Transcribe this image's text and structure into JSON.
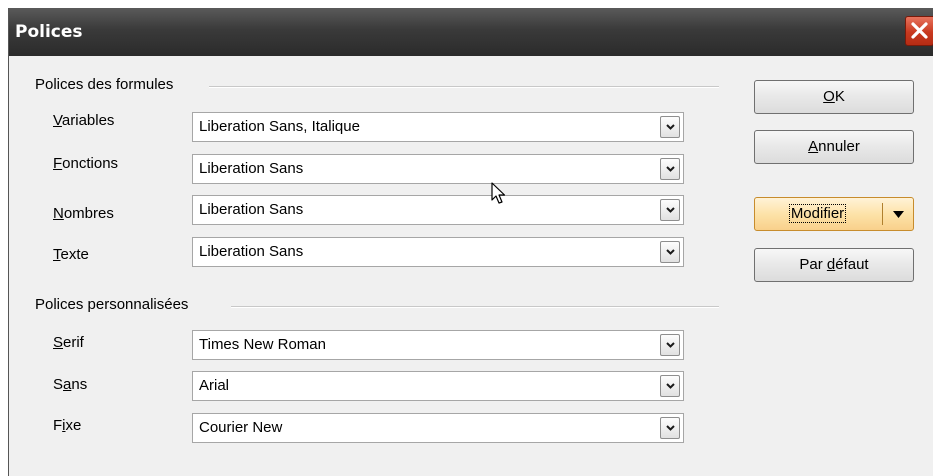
{
  "window": {
    "title": "Polices"
  },
  "groups": {
    "formulas": {
      "label": "Polices des formules",
      "fields": [
        {
          "label": "Variables",
          "key": "V",
          "rest": "ariables",
          "value": "Liberation Sans, Italique"
        },
        {
          "label": "Fonctions",
          "key": "F",
          "rest": "onctions",
          "value": "Liberation Sans"
        },
        {
          "label": "Nombres",
          "key": "N",
          "rest": "ombres",
          "value": "Liberation Sans"
        },
        {
          "label": "Texte",
          "key": "T",
          "rest": "exte",
          "value": "Liberation Sans"
        }
      ]
    },
    "custom": {
      "label": "Polices personnalisées",
      "fields": [
        {
          "label": "Serif",
          "key": "S",
          "rest": "erif",
          "value": "Times New Roman"
        },
        {
          "label": "Sans",
          "pre": "S",
          "key": "a",
          "rest": "ns",
          "value": "Arial"
        },
        {
          "label": "Fixe",
          "pre": "F",
          "key": "i",
          "rest": "xe",
          "value": "Courier New"
        }
      ]
    }
  },
  "buttons": {
    "ok": {
      "label": "OK",
      "key": "O",
      "rest": "K"
    },
    "cancel": {
      "label": "Annuler",
      "key": "A",
      "rest": "nnuler"
    },
    "modify": {
      "label": "Modifier"
    },
    "default": {
      "label": "Par défaut",
      "pre": "Par ",
      "key": "d",
      "rest": "éfaut"
    }
  },
  "icons": {
    "close": "close-icon",
    "dropdown": "chevron-down-icon",
    "cursor": "mouse-pointer-icon"
  },
  "colors": {
    "titlebar": "#3a3a3a",
    "close_button": "#c8391f",
    "dialog_background": "#f0f0f0",
    "modify_button": "#fde3a9"
  }
}
